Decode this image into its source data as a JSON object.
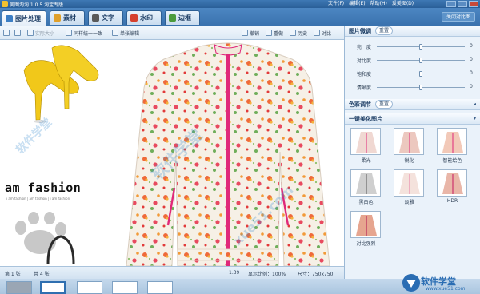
{
  "window": {
    "title": "美图淘淘 1.0.5 淘宝专版",
    "menus": [
      "文件(F)",
      "编辑(E)",
      "帮助(H)",
      "爱美图(D)"
    ]
  },
  "tabs": [
    {
      "label": "图片处理",
      "active": true
    },
    {
      "label": "素材",
      "active": false
    },
    {
      "label": "文字",
      "active": false
    },
    {
      "label": "水印",
      "active": false
    },
    {
      "label": "边框",
      "active": false
    }
  ],
  "close_compare_label": "关闭对比图",
  "toolbar": {
    "actual_size": "实际大小",
    "batch_unify": "同样统一一致",
    "single_edit": "单张编辑",
    "undo": "撤销",
    "redo": "重做",
    "history": "历史",
    "compare": "对比"
  },
  "canvas": {
    "fashion_text": "am fashion",
    "fashion_sub": "i am fashion | am fashion | i am fashion",
    "watermarks": [
      "软件学堂",
      "xue51.com",
      "软件学堂"
    ]
  },
  "status": {
    "page": "第 1 张",
    "total": "共 4 张",
    "size_kb": "1.39",
    "zoom": "显示比例：100%",
    "dimensions": "尺寸：750x750"
  },
  "panel": {
    "adjust": {
      "title": "图片微调",
      "reset": "重置",
      "sliders": [
        {
          "label": "亮　度",
          "value": "0",
          "level": 0.5
        },
        {
          "label": "对比度",
          "value": "0",
          "level": 0.5
        },
        {
          "label": "饱和度",
          "value": "0",
          "level": 0.5
        },
        {
          "label": "清晰度",
          "value": "0",
          "level": 0.5
        }
      ]
    },
    "color": {
      "title": "色彩调节",
      "reset": "重置"
    },
    "beauty": {
      "title": "一键美化图片",
      "presets": [
        "柔光",
        "锐化",
        "智能绘色",
        "黑白色",
        "淡雅",
        "HDR",
        "对比强烈"
      ]
    }
  },
  "brand": {
    "name": "软件学堂",
    "url": "www.xue51.com"
  },
  "colors": {
    "accent": "#3a72ae",
    "pink_zip": "#e0297a",
    "shoe_yellow": "#f2cc1c"
  }
}
